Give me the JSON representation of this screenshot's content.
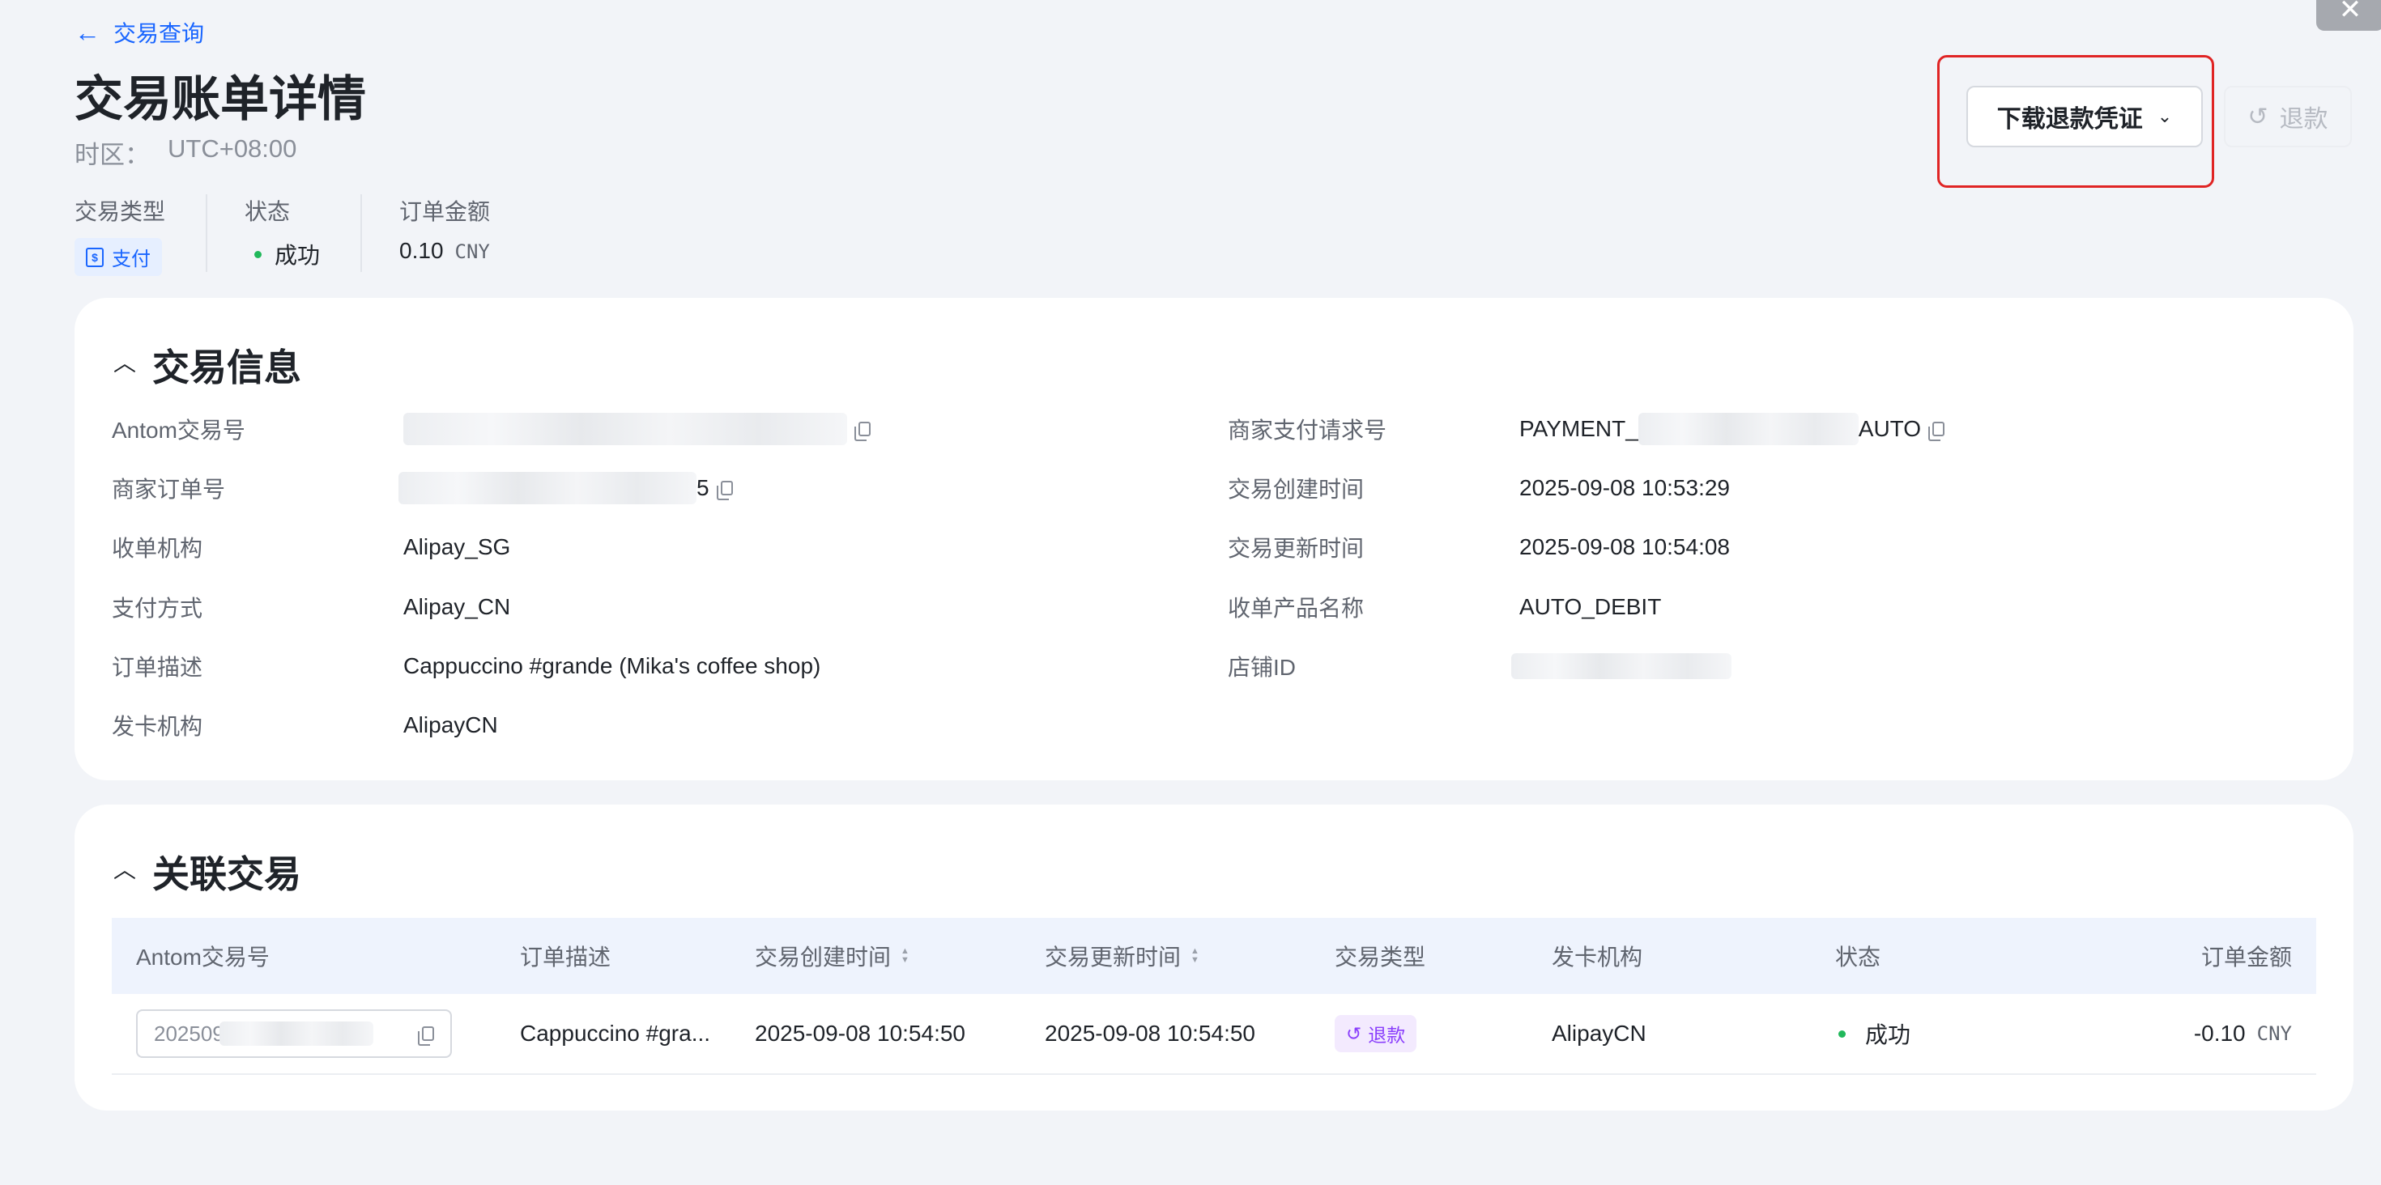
{
  "header": {
    "back_label": "交易查询",
    "back_arrow": "←",
    "title": "交易账单详情",
    "timezone_label": "时区：",
    "timezone_value": "UTC+08:00"
  },
  "actions": {
    "download_label": "下载退款凭证",
    "download_chevron": "⌄",
    "refund_icon": "↺",
    "refund_label": "退款",
    "close_icon": "✕"
  },
  "summary": {
    "type_label": "交易类型",
    "type_value": "支付",
    "status_label": "状态",
    "status_value": "成功",
    "amount_label": "订单金额",
    "amount_value": "0.10",
    "amount_currency": "CNY"
  },
  "transaction_info": {
    "title": "交易信息",
    "left": [
      {
        "label": "Antom交易号",
        "value": ""
      },
      {
        "label": "商家订单号",
        "value": "5"
      },
      {
        "label": "收单机构",
        "value": "Alipay_SG"
      },
      {
        "label": "支付方式",
        "value": "Alipay_CN"
      },
      {
        "label": "订单描述",
        "value": "Cappuccino #grande (Mika's coffee shop)"
      },
      {
        "label": "发卡机构",
        "value": "AlipayCN"
      }
    ],
    "right": [
      {
        "label": "商家支付请求号",
        "value_prefix": "PAYMENT_",
        "value_suffix": "AUTO"
      },
      {
        "label": "交易创建时间",
        "value": "2025-09-08 10:53:29"
      },
      {
        "label": "交易更新时间",
        "value": "2025-09-08 10:54:08"
      },
      {
        "label": "收单产品名称",
        "value": "AUTO_DEBIT"
      },
      {
        "label": "店铺ID",
        "value": ""
      }
    ]
  },
  "related": {
    "title": "关联交易",
    "columns": [
      "Antom交易号",
      "订单描述",
      "交易创建时间",
      "交易更新时间",
      "交易类型",
      "发卡机构",
      "状态",
      "订单金额"
    ],
    "rows": [
      {
        "id_visible": "202509",
        "description": "Cappuccino #gra...",
        "created": "2025-09-08 10:54:50",
        "updated": "2025-09-08 10:54:50",
        "type": "退款",
        "issuer": "AlipayCN",
        "status": "成功",
        "amount": "-0.10",
        "currency": "CNY"
      }
    ]
  },
  "colors": {
    "accent": "#1a66ff",
    "success": "#21b85b",
    "highlight_box": "#e02424",
    "refund_tag": "#8a3ffc"
  }
}
